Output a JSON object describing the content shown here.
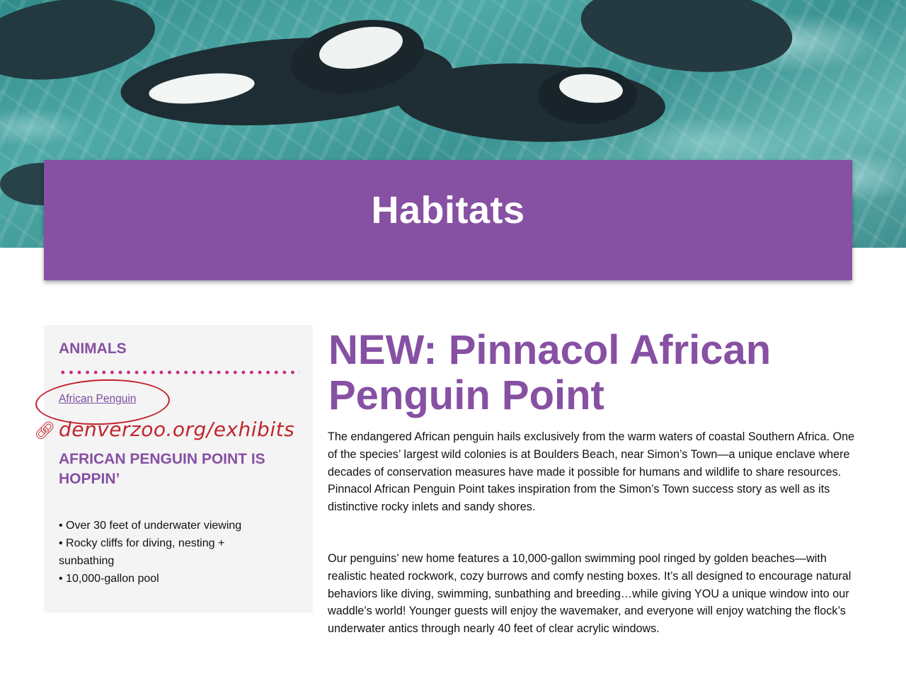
{
  "header": {
    "title": "Habitats"
  },
  "sidebar": {
    "heading": "ANIMALS",
    "animal_link": "African Penguin",
    "annotation_url": "denverzoo.org/exhibits",
    "subheading": "AFRICAN PENGUIN POINT IS HOPPIN’",
    "bullets": [
      "• Over 30 feet of underwater viewing",
      "• Rocky cliffs for diving, nesting + sunbathing",
      "• 10,000-gallon pool"
    ]
  },
  "main": {
    "title": "NEW: Pinnacol African Penguin Point",
    "paragraphs": [
      "The endangered African penguin hails exclusively from the warm waters of coastal Southern Africa. One of the species’ largest wild colonies is at Boulders Beach, near Simon’s Town—a unique enclave where decades of conservation measures have made it possible for humans and wildlife to share resources. Pinnacol African Penguin Point takes inspiration from the Simon’s Town success story as well as its distinctive rocky inlets and sandy shores.",
      "Our penguins’ new home features a 10,000-gallon swimming pool ringed by golden beaches—with realistic heated rockwork, cozy burrows and comfy nesting boxes. It’s all designed to encourage natural behaviors like diving, swimming, sunbathing and breeding…while giving YOU a unique window into our waddle’s world! Younger guests will enjoy the wavemaker, and everyone will enjoy watching the flock’s underwater antics through nearly 40 feet of clear acrylic windows."
    ]
  },
  "colors": {
    "brand_purple": "#8650a3",
    "accent_magenta": "#c2307f",
    "annotation_red": "#c0242c"
  },
  "icons": {
    "annotation_link": "link-chain-icon"
  }
}
